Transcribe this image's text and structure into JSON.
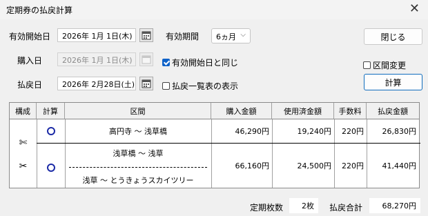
{
  "window": {
    "title": "定期券の払戻計算"
  },
  "form": {
    "start_label": "有効開始日",
    "start_value": "2026年 1月 1日(木)",
    "purchase_label": "購入日",
    "purchase_value": "2026年 1月 1日(木)",
    "refund_label": "払戻日",
    "refund_value": "2026年 2月28日(土)",
    "period_label": "有効期間",
    "period_value": "6ヵ月",
    "same_as_start_label": "有効開始日と同じ",
    "same_as_start_checked": true,
    "show_list_label": "払戻一覧表の表示",
    "show_list_checked": false,
    "route_change_label": "区間変更",
    "route_change_checked": false
  },
  "buttons": {
    "close": "閉じる",
    "calc": "計算"
  },
  "table": {
    "headers": [
      "構成",
      "計算",
      "区間",
      "購入金額",
      "使用済金額",
      "手数料",
      "払戻金額"
    ],
    "rows": [
      {
        "segments": [
          "高円寺 ～ 浅草橋"
        ],
        "purchase": "46,290円",
        "used": "19,240円",
        "fee": "220円",
        "refund": "26,830円"
      },
      {
        "segments": [
          "浅草橋 ～ 浅草",
          "浅草 ～ とうきょうスカイツリー"
        ],
        "purchase": "66,160円",
        "used": "24,500円",
        "fee": "220円",
        "refund": "41,440円"
      }
    ]
  },
  "footer": {
    "count_label": "定期枚数",
    "count_value": "2枚",
    "total_label": "払戻合計",
    "total_value": "68,270円"
  }
}
